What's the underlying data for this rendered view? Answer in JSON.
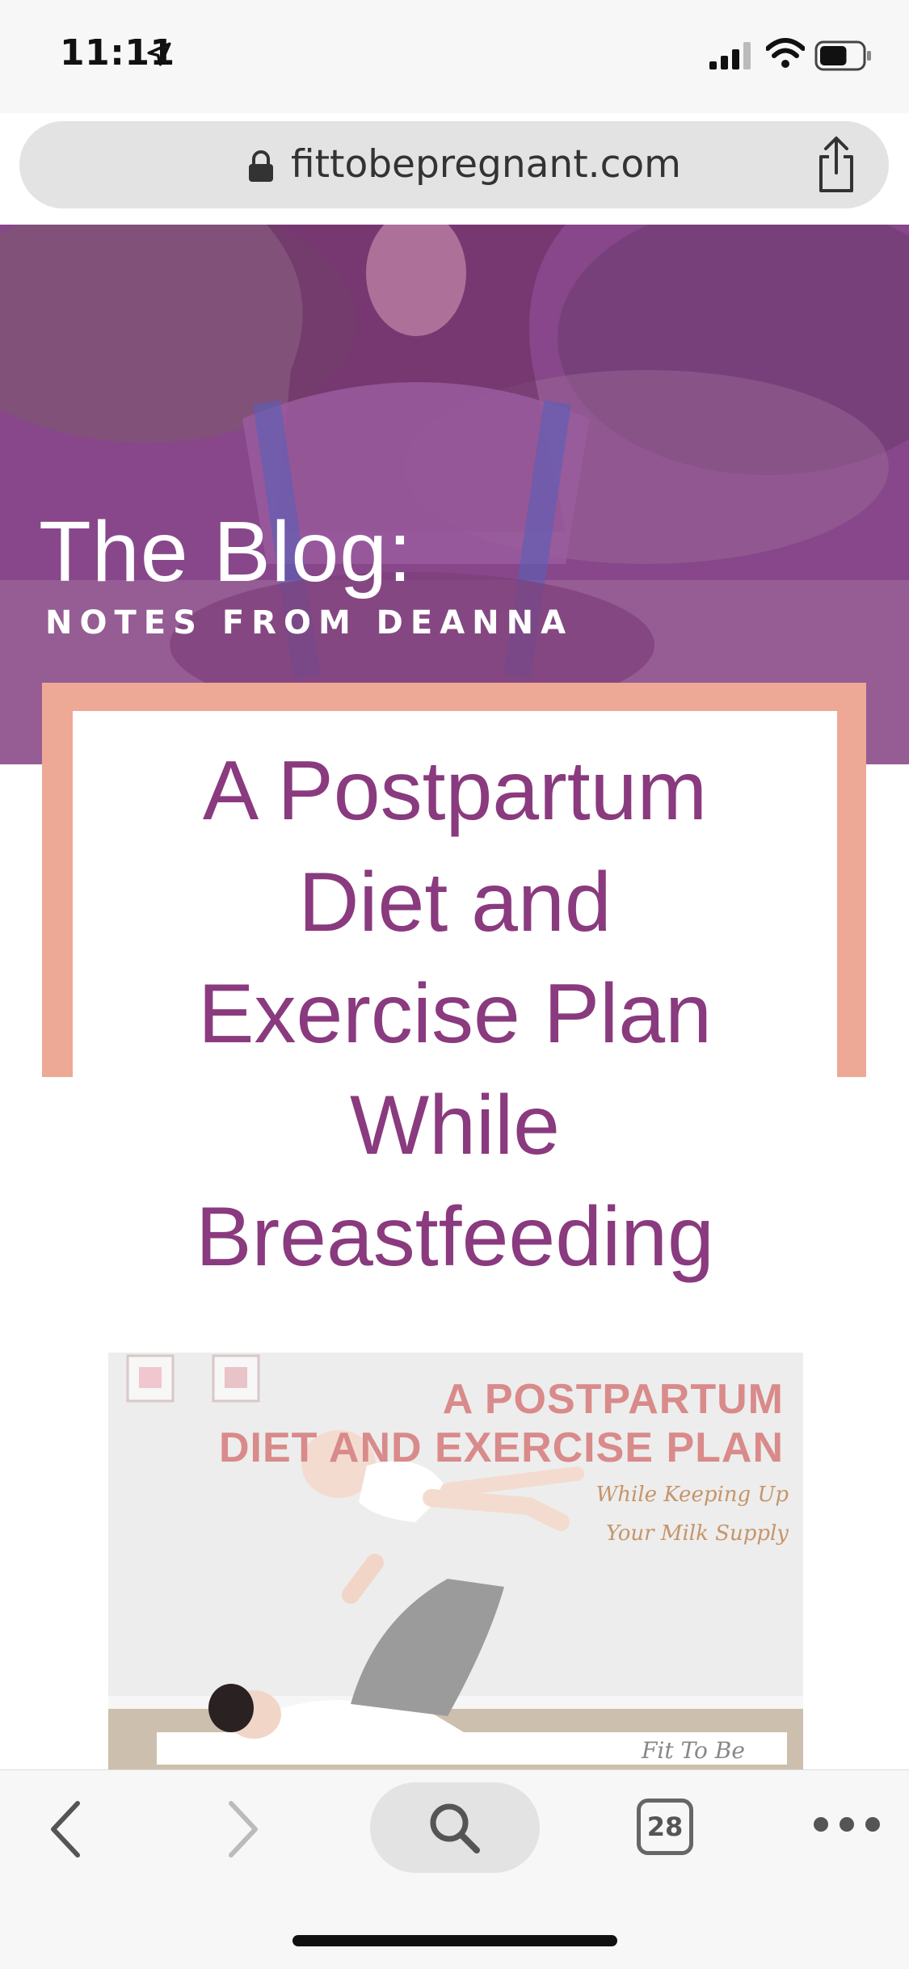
{
  "status_bar": {
    "time": "11:11",
    "battery_level": 0.65
  },
  "browser": {
    "url": "fittobepregnant.com",
    "tab_count": "28"
  },
  "hero": {
    "title": "The Blog:",
    "subtitle": "NOTES FROM DEANNA"
  },
  "post": {
    "title_lines": [
      "A Postpartum",
      "Diet and",
      "Exercise Plan",
      "While",
      "Breastfeeding"
    ]
  },
  "featured_image": {
    "heading_lines": [
      "A POSTPARTUM",
      "DIET AND EXERCISE PLAN"
    ],
    "script_lines": [
      "While Keeping Up",
      "Your Milk Supply"
    ],
    "logo_text": "Fit To Be"
  },
  "colors": {
    "brand_purple": "#8a3a7e",
    "hero_overlay": "#8a4587",
    "frame_peach": "#eda896"
  },
  "icons": [
    "location-arrow-icon",
    "signal-icon",
    "wifi-icon",
    "battery-icon",
    "lock-icon",
    "share-icon",
    "back-icon",
    "forward-icon",
    "search-icon",
    "tabs-icon",
    "more-icon"
  ]
}
